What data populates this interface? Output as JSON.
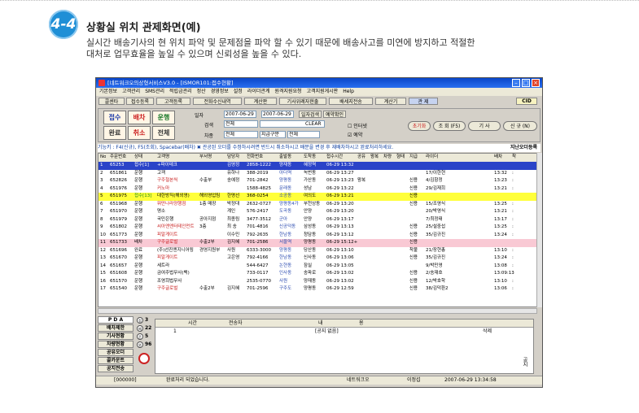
{
  "section": {
    "number": "4-4",
    "title": "상황실 위치 관제화면(예)",
    "description": "실시간 배송기사의 현 위치 파악 및 문제점을 파악 할 수 있기 때문에 배송사고를 미연에 방지하고 적절한\n대처로 업무효율을 높일 수 있으며 신뢰성을 높을 수 있다."
  },
  "window": {
    "title": "[네트워크오의상형서비스V3.0 - [ISMOR101:접수현황]",
    "menu": [
      "기본정보",
      "고객관리",
      "SMS관리",
      "적립금관리",
      "정산",
      "경영정보",
      "설정",
      "라이더관계",
      "원격지원요청",
      "고객지원게시판",
      "Help"
    ],
    "toolbar": [
      "콜센타",
      "접수등록",
      "고객등록",
      "전화수신내역",
      "계산판",
      "기사위례자현출",
      "배세지전송",
      "계산기",
      "관 제"
    ],
    "cid_label": "CID",
    "controls": {
      "btn_accept": "접수",
      "btn_dispatch": "배차",
      "btn_drive": "운행",
      "btn_done": "완료",
      "btn_cancel": "취소",
      "btn_all": "전체",
      "label_date": "일자",
      "date_from": "2007-06-29",
      "date_to": "2007-06-29",
      "btn_date_search": "일자검색",
      "btn_reserve": "예약확인",
      "label_search": "검색",
      "search_sel": "전체",
      "btn_clear": "CLEAR",
      "label_car": "차종",
      "car_sel": "전체",
      "pay_sel": "지급구분",
      "pay_val": "전체",
      "chk_internet": "인터넷",
      "chk_reserve": "예약",
      "btn_reset": "초기화",
      "btn_lookup": "조 회 (F5)",
      "btn_driver": "기 사",
      "btn_new": "신 규 (N)"
    },
    "notice": "기능키 : F4(신규), F5(조회), Spacebar(배차)  ✖ 관공된 오더를 수정하시려면 반드시 취소하시고 배분을 변경 후 재배차하시고 완료처리하세요.",
    "notice_right": "지난오더등록",
    "columns": [
      "No",
      "주문번호",
      "상태",
      "고객명",
      "부서명",
      "담당자",
      "전화번호",
      "출발동",
      "도착동",
      "접수시간",
      "공유",
      "왕복",
      "차량",
      "형태",
      "지급",
      "라이더",
      "배차",
      "착"
    ],
    "rows": [
      [
        "1",
        "65253",
        "접수[1]",
        "+파이테크",
        "",
        "김영정",
        "2858-1222",
        "양재동",
        "혜정역",
        "06-29 13:32",
        "",
        "",
        "",
        "",
        "",
        "",
        "",
        ""
      ],
      [
        "2",
        "651861",
        "운행",
        "고객",
        "",
        "유하나",
        "388-2019",
        "아더역",
        "녹번동",
        "06-29 13:27",
        "",
        "",
        "",
        "",
        "",
        "17/이한현",
        "13:32",
        ":"
      ],
      [
        "3",
        "652826",
        "운행",
        "구주철본씩",
        "수출부",
        "송예정",
        "701-2842",
        "양평동",
        "가산동",
        "06-29 13:23",
        "왕복",
        "",
        "",
        "",
        "신용",
        "4/김항정",
        "13:23",
        ":"
      ],
      [
        "4",
        "651976",
        "운행",
        "커노마",
        "",
        "",
        "1588-4825",
        "문래동",
        "성남",
        "06-29 13:22",
        "",
        "",
        "",
        "",
        "신용",
        "29/김재희",
        "13:21",
        ":"
      ],
      [
        "5",
        "651975",
        "접수[13]",
        "대한방직(해외영)",
        "해외영업팀",
        "한명선",
        "368-0254",
        "소공동",
        "여의도",
        "06-29 13:21",
        "",
        "",
        "",
        "",
        "신용",
        "",
        "",
        ""
      ],
      [
        "6",
        "651968",
        "운행",
        "뭐만나라양행점",
        "1층 매장",
        "박정대",
        "2632-0727",
        "양평동4가",
        "부천상동",
        "06-29 13:20",
        "",
        "",
        "",
        "",
        "신용",
        "15/조영식",
        "13:25",
        ":"
      ],
      [
        "7",
        "651970",
        "운행",
        "명소",
        "",
        "계인",
        "576-2417",
        "도곡동",
        "안양",
        "06-29 13:20",
        "",
        "",
        "",
        "",
        "",
        "20/박영식",
        "13:21",
        ":"
      ],
      [
        "8",
        "651979",
        "운행",
        "국민은행",
        "공아지점",
        "최종림",
        "3477-3512",
        "군아",
        "안양",
        "06-29 13:17",
        "",
        "",
        "",
        "",
        "",
        "7/최정태",
        "13:17",
        ":"
      ],
      [
        "9",
        "651802",
        "운행",
        "씨아엔엔터테인먼트",
        "3층",
        "최 송",
        "701-4816",
        "신공덕동",
        "삼성동",
        "06-29 13:13",
        "",
        "",
        "",
        "",
        "신용",
        "25/설중섭",
        "13:25",
        ":"
      ],
      [
        "10",
        "651773",
        "운행",
        "피알게이트",
        "",
        "이수민",
        "792-2635",
        "한남동",
        "청담동",
        "06-29 13:12",
        "",
        "",
        "",
        "",
        "신용",
        "35/김규진",
        "13:24",
        ":"
      ],
      [
        "11",
        "651733",
        "배차",
        "구주글로벌",
        "수출2부",
        "김지혜",
        "701-2586",
        "서울역",
        "양평동",
        "06-29 15:12+",
        "",
        "",
        "",
        "",
        "신용",
        "",
        "",
        ""
      ],
      [
        "12",
        "651696",
        "완료",
        "(주)선진엔지니어링",
        "경영지원부",
        "사원",
        "6333-3000",
        "양평동",
        "당산동",
        "06-29 13:10",
        "",
        "",
        "",
        "",
        "착불",
        "21/장현총",
        "13:10",
        ":"
      ],
      [
        "13",
        "651670",
        "운행",
        "피알게이트",
        "",
        "고은영",
        "792-4166",
        "한남동",
        "신사동",
        "06-29 13:06",
        "",
        "",
        "",
        "",
        "신용",
        "35/김규진",
        "13:24",
        ":"
      ],
      [
        "14",
        "651657",
        "운행",
        "세트라",
        "",
        "",
        "544-6427",
        "논현동",
        "잠실",
        "06-29 13:05",
        "",
        "",
        "",
        "",
        "",
        "9/박민영",
        "13:08",
        ":"
      ],
      [
        "15",
        "651608",
        "운행",
        "금여주법무사(백)",
        "",
        "",
        "733-0117",
        "인사동",
        "송파로",
        "06-29 13:02",
        "",
        "",
        "",
        "",
        "신용",
        "2/송재호",
        "13:09:13",
        ":"
      ],
      [
        "16",
        "651570",
        "운행",
        "조영희법무사",
        "",
        "",
        "2535-0770",
        "사원",
        "양재동",
        "06-29 13:02",
        "",
        "",
        "",
        "",
        "신용",
        "12/박호학",
        "13:10",
        ":"
      ],
      [
        "17",
        "651540",
        "운행",
        "구주글로벌",
        "수출2부",
        "김지혜",
        "701-2596",
        "구주도",
        "양평동",
        "06-29 12:59",
        "",
        "",
        "",
        "",
        "신용",
        "38/김덕환2",
        "13:06",
        ":"
      ]
    ],
    "left_panel": {
      "pda": "P D A",
      "b1": "배차제한",
      "b2": "기사현황",
      "b3": "차량현황",
      "b4": "공유오더",
      "b5": "콜카운트",
      "b6": "공지전송",
      "c1": "3",
      "c2": "22",
      "c3": "5",
      "c4": "96"
    },
    "lower_cols": [
      "시간",
      "전송자",
      "내",
      "용"
    ],
    "lower_row": {
      "no": "1",
      "content": "[공지 없음]",
      "btn": "삭제"
    },
    "lower_side": "공지",
    "status": {
      "code": "[000000]",
      "msg": "완료처리 되었습니다.",
      "company": "네트워크오",
      "user": "이정섭",
      "datetime": "2007-06-29 13:34:58"
    }
  }
}
